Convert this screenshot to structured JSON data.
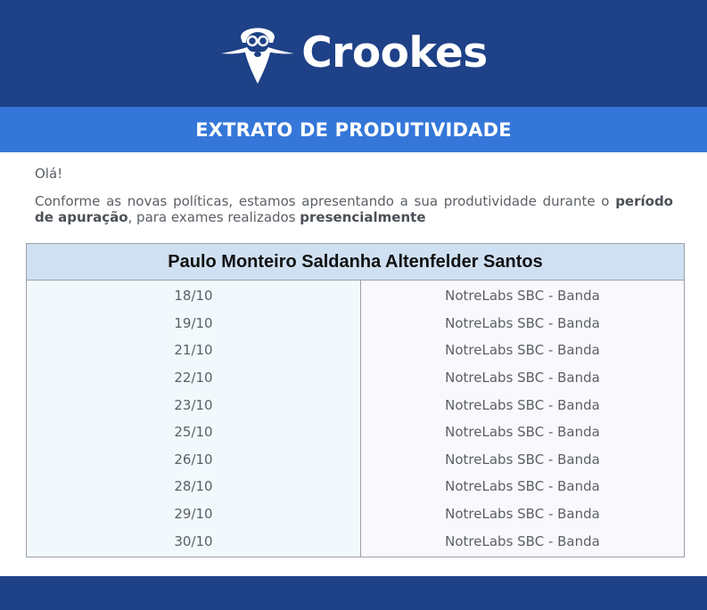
{
  "header": {
    "brand": "Crookes",
    "logo_icon": "bearded-scientist-icon",
    "background": "#1e4187"
  },
  "banner": {
    "title": "EXTRATO DE PRODUTIVIDADE",
    "background": "#3577d9"
  },
  "message": {
    "greeting": "Olá!",
    "intro_part1": "Conforme as novas políticas, estamos apresentando a sua produtividade durante o ",
    "intro_bold1": "período de apuração",
    "intro_part2": ", para exames realizados ",
    "intro_bold2": "presencialmente"
  },
  "table": {
    "person_name": "Paulo Monteiro Saldanha Altenfelder Santos",
    "rows": [
      {
        "date": "18/10",
        "location": "NotreLabs SBC - Banda"
      },
      {
        "date": "19/10",
        "location": "NotreLabs SBC - Banda"
      },
      {
        "date": "21/10",
        "location": "NotreLabs SBC - Banda"
      },
      {
        "date": "22/10",
        "location": "NotreLabs SBC - Banda"
      },
      {
        "date": "23/10",
        "location": "NotreLabs SBC - Banda"
      },
      {
        "date": "25/10",
        "location": "NotreLabs SBC - Banda"
      },
      {
        "date": "26/10",
        "location": "NotreLabs SBC - Banda"
      },
      {
        "date": "28/10",
        "location": "NotreLabs SBC - Banda"
      },
      {
        "date": "29/10",
        "location": "NotreLabs SBC - Banda"
      },
      {
        "date": "30/10",
        "location": "NotreLabs SBC - Banda"
      }
    ]
  }
}
